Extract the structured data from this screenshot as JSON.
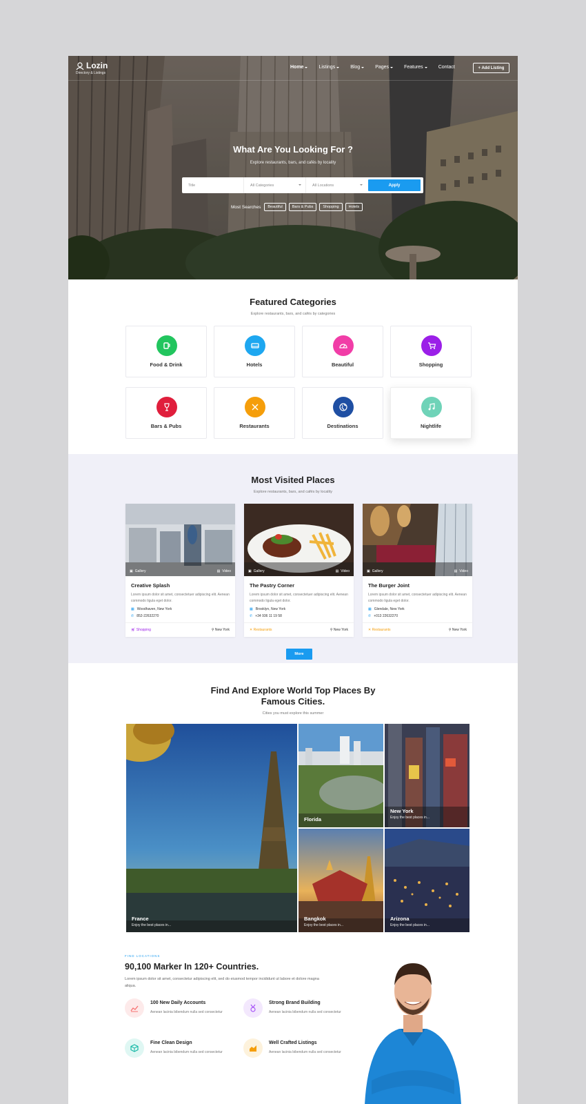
{
  "header": {
    "logo_name": "Lozin",
    "logo_tagline": "Directory & Listings",
    "nav": [
      {
        "label": "Home",
        "dropdown": true,
        "active": true
      },
      {
        "label": "Listings",
        "dropdown": true
      },
      {
        "label": "Blog",
        "dropdown": true
      },
      {
        "label": "Pages",
        "dropdown": true
      },
      {
        "label": "Features",
        "dropdown": true
      },
      {
        "label": "Contact",
        "dropdown": false
      }
    ],
    "add_listing_label": "+ Add Listing"
  },
  "hero": {
    "title": "What Are You Looking For ?",
    "subtitle": "Explore restaurants, bars, and cafés by locality",
    "search": {
      "title_placeholder": "Title",
      "category_value": "All Categories",
      "location_value": "All Locations",
      "apply_label": "Apply"
    },
    "most_searches_label": "Most Searches",
    "tags": [
      "Beautiful",
      "Bars & Pubs",
      "Shopping",
      "Hotels"
    ]
  },
  "featured": {
    "title": "Featured Categories",
    "subtitle": "Explore restaurants, bars, and cafés by categories",
    "categories": [
      {
        "label": "Food & Drink",
        "icon": "coffee-cup-icon",
        "color": "#22c55e"
      },
      {
        "label": "Hotels",
        "icon": "bed-icon",
        "color": "#1ea7f0"
      },
      {
        "label": "Beautiful",
        "icon": "gauge-icon",
        "color": "#f13da7"
      },
      {
        "label": "Shopping",
        "icon": "cart-icon",
        "color": "#9b1fe8"
      },
      {
        "label": "Bars & Pubs",
        "icon": "wine-glass-icon",
        "color": "#e01e3c"
      },
      {
        "label": "Restaurants",
        "icon": "utensils-icon",
        "color": "#f59e0b"
      },
      {
        "label": "Destinations",
        "icon": "globe-icon",
        "color": "#1f4fa3"
      },
      {
        "label": "Nightlife",
        "icon": "music-icon",
        "color": "#6fd3b8"
      }
    ]
  },
  "visited": {
    "title": "Most Visited Places",
    "subtitle": "Explore restaurants, bars, and cafés by locality",
    "gallery_label": "Gallery",
    "video_label": "Video",
    "places": [
      {
        "name": "Creative Splash",
        "description": "Lorem ipsum dolor sit amet, consectetuer adipiscing elit. Aenean commodo ligula eget dolor.",
        "address": "Woodhaven, New York",
        "phone": "852-22632270",
        "category": "Shopping",
        "category_color": "#9b1fe8",
        "city": "New York"
      },
      {
        "name": "The Pastry Corner",
        "description": "Lorem ipsum dolor sit amet, consectetuer adipiscing elit. Aenean commodo ligula eget dolor.",
        "address": "Brooklyn, New York",
        "phone": "+34 936 11 19 58",
        "category": "Restaurants",
        "category_color": "#f59e0b",
        "city": "New York"
      },
      {
        "name": "The Burger Joint",
        "description": "Lorem ipsum dolor sit amet, consectetuer adipiscing elit. Aenean commodo ligula eget dolor.",
        "address": "Glendale, New York",
        "phone": "+013 22632270",
        "category": "Restaurants",
        "category_color": "#f59e0b",
        "city": "New York"
      }
    ],
    "more_label": "More"
  },
  "cities": {
    "title_line1": "Find And Explore World Top Places By",
    "title_line2": "Famous Cities.",
    "subtitle": "Cities you must explore this summer",
    "tiles": [
      {
        "name": "France",
        "sub": "Enjoy the best places in..."
      },
      {
        "name": "Florida",
        "sub": ""
      },
      {
        "name": "New York",
        "sub": "Enjoy the best places in..."
      },
      {
        "name": "Bangkok",
        "sub": "Enjoy the best places in..."
      },
      {
        "name": "Arizona",
        "sub": "Enjoy the best places in..."
      }
    ]
  },
  "marker": {
    "eyebrow": "FIND LOCATIONS",
    "title": "90,100 Marker In 120+ Countries.",
    "text": "Lorem ipsum dolor sit amet, consectetur adipiscing elit, sed do eiusmod tempor incididunt ut labore et dolore magna aliqua.",
    "features": [
      {
        "title": "100 New Daily Accounts",
        "desc": "Aenean lacinia bibendum nulla sed consectetur",
        "icon": "chart-icon",
        "color": "#f87171",
        "bg": "#fdeaea"
      },
      {
        "title": "Strong Brand Building",
        "desc": "Aenean lacinia bibendum nulla sed consectetur",
        "icon": "medal-icon",
        "color": "#a855f7",
        "bg": "#f3e8fd"
      },
      {
        "title": "Fine Clean Design",
        "desc": "Aenean lacinia bibendum nulla sed consectetur",
        "icon": "cube-icon",
        "color": "#14b8a6",
        "bg": "#dff7f3"
      },
      {
        "title": "Well Crafted Listings",
        "desc": "Aenean lacinia bibendum nulla sed consectetur",
        "icon": "area-chart-icon",
        "color": "#f59e0b",
        "bg": "#fdf2dc"
      }
    ]
  }
}
